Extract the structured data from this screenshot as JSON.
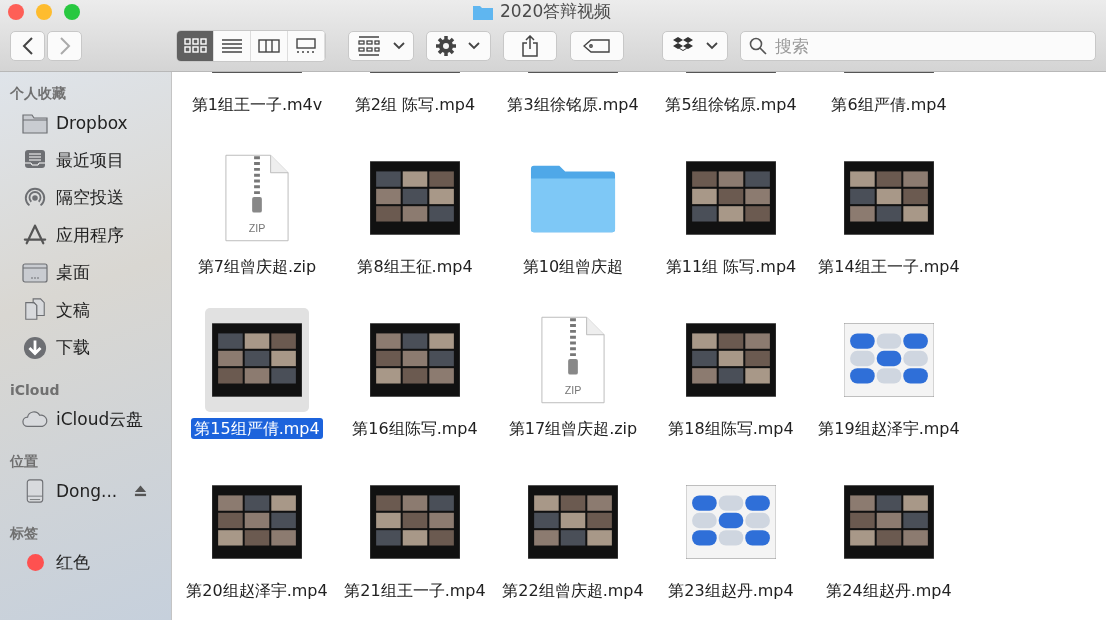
{
  "window": {
    "title": "2020答辩视频"
  },
  "toolbar": {
    "views": [
      {
        "kind": "icons",
        "selected": true
      },
      {
        "kind": "list",
        "selected": false
      },
      {
        "kind": "columns",
        "selected": false
      },
      {
        "kind": "gallery",
        "selected": false
      }
    ],
    "search": {
      "placeholder": "搜索"
    }
  },
  "sidebar": {
    "sections": [
      {
        "title": "个人收藏",
        "items": [
          {
            "label": "Dropbox"
          },
          {
            "label": "最近项目"
          },
          {
            "label": "隔空投送"
          },
          {
            "label": "应用程序"
          },
          {
            "label": "桌面"
          },
          {
            "label": "文稿"
          },
          {
            "label": "下载"
          }
        ]
      },
      {
        "title": "iCloud",
        "items": [
          {
            "label": "iCloud云盘"
          }
        ]
      },
      {
        "title": "位置",
        "items": [
          {
            "label": "Dong..."
          }
        ]
      },
      {
        "title": "标签",
        "items": [
          {
            "label": "红色",
            "color": "#fe5150"
          }
        ]
      }
    ]
  },
  "files": [
    {
      "name": "第1组王一子.m4v",
      "kind": "video",
      "selected": false
    },
    {
      "name": "第2组 陈写.mp4",
      "kind": "video",
      "selected": false
    },
    {
      "name": "第3组徐铭原.mp4",
      "kind": "video",
      "selected": false
    },
    {
      "name": "第5组徐铭原.mp4",
      "kind": "video",
      "selected": false
    },
    {
      "name": "第6组严倩.mp4",
      "kind": "video",
      "selected": false
    },
    {
      "name": "第7组曾庆超.zip",
      "kind": "zip",
      "badge": "ZIP",
      "selected": false
    },
    {
      "name": "第8组王征.mp4",
      "kind": "video",
      "selected": false
    },
    {
      "name": "第10组曾庆超",
      "kind": "folder",
      "selected": false
    },
    {
      "name": "第11组 陈写.mp4",
      "kind": "video",
      "selected": false
    },
    {
      "name": "第14组王一子.mp4",
      "kind": "video",
      "selected": false
    },
    {
      "name": "第15组严倩.mp4",
      "kind": "video",
      "selected": true
    },
    {
      "name": "第16组陈写.mp4",
      "kind": "video",
      "selected": false
    },
    {
      "name": "第17组曾庆超.zip",
      "kind": "zip",
      "badge": "ZIP",
      "selected": false
    },
    {
      "name": "第18组陈写.mp4",
      "kind": "video",
      "selected": false
    },
    {
      "name": "第19组赵泽宇.mp4",
      "kind": "video",
      "selected": false
    },
    {
      "name": "第20组赵泽宇.mp4",
      "kind": "video",
      "selected": false
    },
    {
      "name": "第21组王一子.mp4",
      "kind": "video",
      "selected": false
    },
    {
      "name": "第22组曾庆超.mp4",
      "kind": "video",
      "selected": false
    },
    {
      "name": "第23组赵丹.mp4",
      "kind": "video",
      "selected": false
    },
    {
      "name": "第24组赵丹.mp4",
      "kind": "video",
      "selected": false
    }
  ]
}
